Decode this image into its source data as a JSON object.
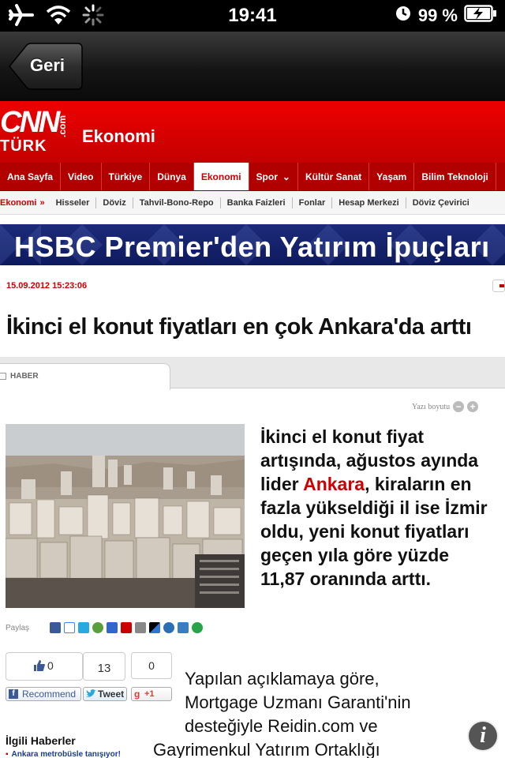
{
  "status_bar": {
    "time": "19:41",
    "battery": "99 %"
  },
  "navbar": {
    "back_label": "Geri"
  },
  "header": {
    "logo_cnn": "CNN",
    "logo_turk": "TÜRK",
    "logo_com": ".com",
    "section": "Ekonomi"
  },
  "main_menu": [
    "Ana Sayfa",
    "Video",
    "Türkiye",
    "Dünya",
    "Ekonomi",
    "Spor",
    "Kültür Sanat",
    "Yaşam",
    "Bilim Teknoloji"
  ],
  "sub_menu": {
    "crumb": "Ekonomi",
    "separator": "»",
    "links": [
      "Hisseler",
      "Döviz",
      "Tahvil-Bono-Repo",
      "Banka Faizleri",
      "Fonlar",
      "Hesap Merkezi",
      "Döviz Çevirici"
    ]
  },
  "banner": {
    "text": "HSBC Premier'den Yatırım İpuçları"
  },
  "article": {
    "date": "15.09.2012 15:23:06",
    "headline": "İkinci el konut fiyatları en çok Ankara'da arttı",
    "tab_label": "HABER",
    "font_size_label": "Yazı boyutu",
    "font_minus": "−",
    "font_plus": "+",
    "lead_before": "İkinci el konut fiyat artışında, ağustos ayında lider ",
    "lead_highlight": "Ankara",
    "lead_after": ", kiraların en fazla yükseldiği il ise İzmir oldu, yeni konut fiyatları geçen yıla göre yüzde 11,87 oranında arttı.",
    "share_label": "Paylaş",
    "body_lines": [
      "Yapılan açıklamaya göre,",
      "Mortgage Uzmanı Garanti'nin",
      "desteğiyle Reidin.com ve",
      "Gayrimenkul Yatırım Ortaklığı"
    ]
  },
  "social": {
    "fb_count": "0",
    "fb_label": "Recommend",
    "tw_count": "13",
    "tw_label": "Tweet",
    "g_count": "0",
    "g_label": "+1"
  },
  "related": {
    "title": "İlgili Haberler",
    "first_item": "Ankara metrobüsle tanışıyor!"
  },
  "colors": {
    "brand_red": "#cc0000",
    "banner_blue": "#1c2b7a",
    "link_blue": "#1a3a9a"
  }
}
